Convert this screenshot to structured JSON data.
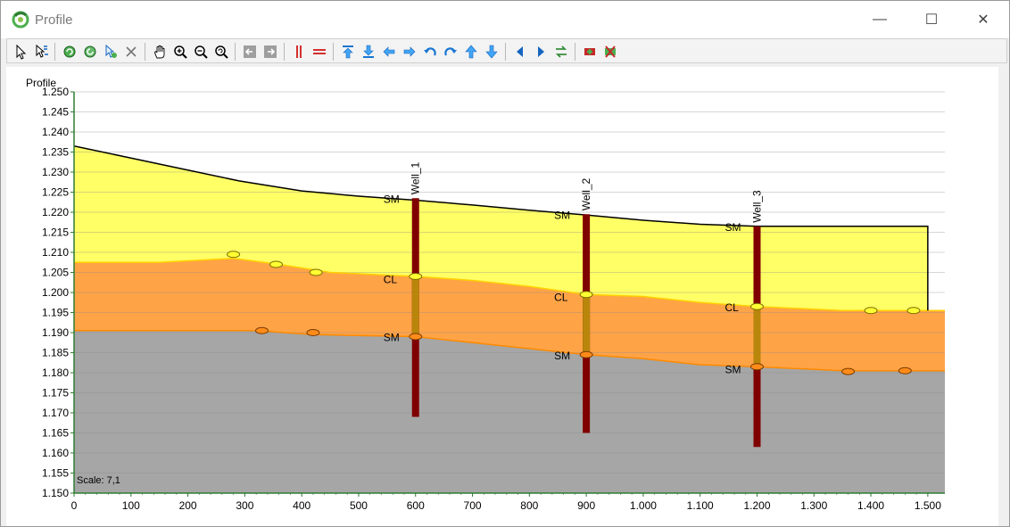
{
  "window": {
    "title": "Profile",
    "minimize_glyph": "—",
    "maximize_glyph": "☐",
    "close_glyph": "✕"
  },
  "toolbar": {
    "groups": [
      [
        "select-arrow-icon",
        "select-multi-icon"
      ],
      [
        "refresh-icon",
        "refresh-alt-icon",
        "select-config-icon",
        "delete-x-icon"
      ],
      [
        "pan-hand-icon",
        "zoom-in-icon",
        "zoom-out-icon",
        "zoom-extent-icon"
      ],
      [
        "page-back-icon",
        "page-forward-icon"
      ],
      [
        "vertical-lines-icon",
        "horizontal-lines-icon"
      ],
      [
        "move-top-icon",
        "move-bottom-icon",
        "move-left-icon",
        "move-right-icon",
        "rotate-left-icon",
        "rotate-right-icon",
        "move-up-icon",
        "move-down-icon"
      ],
      [
        "previous-icon",
        "next-icon",
        "swap-icon"
      ],
      [
        "add-well-icon",
        "remove-well-icon"
      ]
    ]
  },
  "chart_data": {
    "type": "area",
    "title": "Profile",
    "xlim": [
      0,
      1530
    ],
    "ylim": [
      1.15,
      1.25
    ],
    "x_ticks": [
      0,
      100,
      200,
      300,
      400,
      500,
      600,
      700,
      800,
      900,
      1000,
      1100,
      1200,
      1300,
      1400,
      1500
    ],
    "x_tick_labels": [
      "0",
      "100",
      "200",
      "300",
      "400",
      "500",
      "600",
      "700",
      "800",
      "900",
      "1.000",
      "1.100",
      "1.200",
      "1.300",
      "1.400",
      "1.500"
    ],
    "y_ticks": [
      1.15,
      1.155,
      1.16,
      1.165,
      1.17,
      1.175,
      1.18,
      1.185,
      1.19,
      1.195,
      1.2,
      1.205,
      1.21,
      1.215,
      1.22,
      1.225,
      1.23,
      1.235,
      1.24,
      1.245,
      1.25
    ],
    "y_tick_labels": [
      "1.150",
      "1.155",
      "1.160",
      "1.165",
      "1.170",
      "1.175",
      "1.180",
      "1.185",
      "1.190",
      "1.195",
      "1.200",
      "1.205",
      "1.210",
      "1.215",
      "1.220",
      "1.225",
      "1.230",
      "1.235",
      "1.240",
      "1.245",
      "1.250"
    ],
    "grid": "horizontal",
    "scale_label": "Scale: 7,1",
    "surface": [
      [
        0,
        1.2365
      ],
      [
        100,
        1.2335
      ],
      [
        200,
        1.2305
      ],
      [
        290,
        1.2278
      ],
      [
        400,
        1.2253
      ],
      [
        500,
        1.224
      ],
      [
        600,
        1.223
      ],
      [
        700,
        1.2218
      ],
      [
        800,
        1.2205
      ],
      [
        900,
        1.2193
      ],
      [
        1000,
        1.218
      ],
      [
        1100,
        1.217
      ],
      [
        1200,
        1.2165
      ],
      [
        1500,
        1.2165
      ]
    ],
    "boundary_sm_cl": [
      [
        0,
        1.2075
      ],
      [
        150,
        1.2075
      ],
      [
        280,
        1.2085
      ],
      [
        360,
        1.207
      ],
      [
        450,
        1.205
      ],
      [
        600,
        1.204
      ],
      [
        700,
        1.203
      ],
      [
        800,
        1.2015
      ],
      [
        900,
        1.1995
      ],
      [
        1000,
        1.199
      ],
      [
        1100,
        1.1975
      ],
      [
        1200,
        1.1965
      ],
      [
        1350,
        1.1955
      ],
      [
        1530,
        1.1955
      ]
    ],
    "boundary_cl_sm": [
      [
        0,
        1.1905
      ],
      [
        150,
        1.1905
      ],
      [
        320,
        1.1905
      ],
      [
        420,
        1.1895
      ],
      [
        600,
        1.189
      ],
      [
        700,
        1.1875
      ],
      [
        800,
        1.186
      ],
      [
        900,
        1.1845
      ],
      [
        1000,
        1.1835
      ],
      [
        1100,
        1.182
      ],
      [
        1200,
        1.1815
      ],
      [
        1350,
        1.1805
      ],
      [
        1530,
        1.1805
      ]
    ],
    "layers": [
      {
        "name": "SM",
        "color": "#ffff66"
      },
      {
        "name": "CL",
        "color": "#ffa347"
      },
      {
        "name": "SM",
        "color": "#a6a6a6"
      }
    ],
    "wells": [
      {
        "name": "Well_1",
        "x": 600,
        "top": 1.2235,
        "bottom": 1.169,
        "labels": [
          {
            "text": "SM",
            "y": 1.2235
          },
          {
            "text": "CL",
            "y": 1.2035
          },
          {
            "text": "SM",
            "y": 1.189
          }
        ],
        "markers": [
          1.204,
          1.189
        ]
      },
      {
        "name": "Well_2",
        "x": 900,
        "top": 1.2195,
        "bottom": 1.165,
        "labels": [
          {
            "text": "SM",
            "y": 1.2195
          },
          {
            "text": "CL",
            "y": 1.199
          },
          {
            "text": "SM",
            "y": 1.1845
          }
        ],
        "markers": [
          1.1995,
          1.1845
        ]
      },
      {
        "name": "Well_3",
        "x": 1200,
        "top": 1.2165,
        "bottom": 1.1615,
        "labels": [
          {
            "text": "SM",
            "y": 1.2165
          },
          {
            "text": "CL",
            "y": 1.1965
          },
          {
            "text": "SM",
            "y": 1.181
          }
        ],
        "markers": [
          1.1965,
          1.1815
        ]
      }
    ],
    "control_points_sm_cl": [
      [
        280,
        1.2095
      ],
      [
        355,
        1.207
      ],
      [
        425,
        1.205
      ],
      [
        1400,
        1.1955
      ],
      [
        1475,
        1.1955
      ]
    ],
    "control_points_cl_sm": [
      [
        330,
        1.1905
      ],
      [
        420,
        1.19
      ],
      [
        1360,
        1.1803
      ],
      [
        1460,
        1.1805
      ]
    ]
  },
  "colors": {
    "sm_upper": "#ffff66",
    "cl": "#ffa347",
    "sm_lower": "#a6a6a6",
    "well": "#800000",
    "well_cl": "#b8860b",
    "ground_line": "#000000",
    "axis": "#2e7d32"
  }
}
